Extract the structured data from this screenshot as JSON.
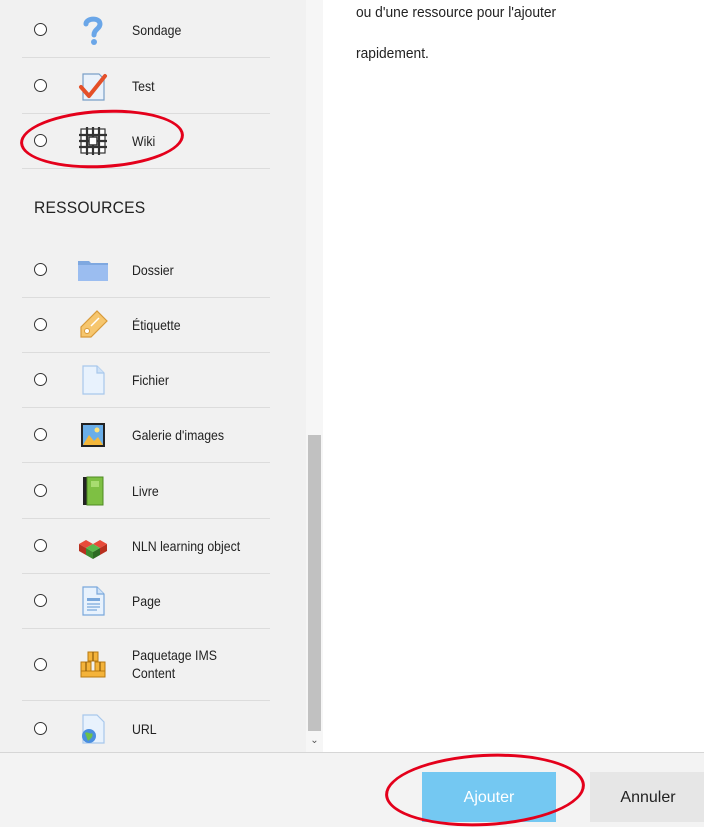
{
  "activities": [
    {
      "label": "Sondage",
      "icon": "question-mark-icon"
    },
    {
      "label": "Test",
      "icon": "checkmark-test-icon"
    },
    {
      "label": "Wiki",
      "icon": "wiki-icon"
    }
  ],
  "resources_heading": "RESSOURCES",
  "resources": [
    {
      "label": "Dossier",
      "icon": "folder-icon"
    },
    {
      "label": "Étiquette",
      "icon": "label-tag-icon"
    },
    {
      "label": "Fichier",
      "icon": "file-icon"
    },
    {
      "label": "Galerie d'images",
      "icon": "image-gallery-icon"
    },
    {
      "label": "Livre",
      "icon": "book-icon"
    },
    {
      "label": "NLN learning object",
      "icon": "cubes-icon"
    },
    {
      "label": "Page",
      "icon": "page-icon"
    },
    {
      "label": "Paquetage IMS Content",
      "icon": "package-boxes-icon"
    },
    {
      "label": "URL",
      "icon": "url-globe-icon"
    }
  ],
  "help_text": {
    "line1": "ou d'une ressource pour l'ajouter",
    "line2": "rapidement."
  },
  "footer": {
    "add_label": "Ajouter",
    "cancel_label": "Annuler"
  },
  "colors": {
    "add_button": "#74c8f2",
    "annotation": "#e4001b"
  }
}
